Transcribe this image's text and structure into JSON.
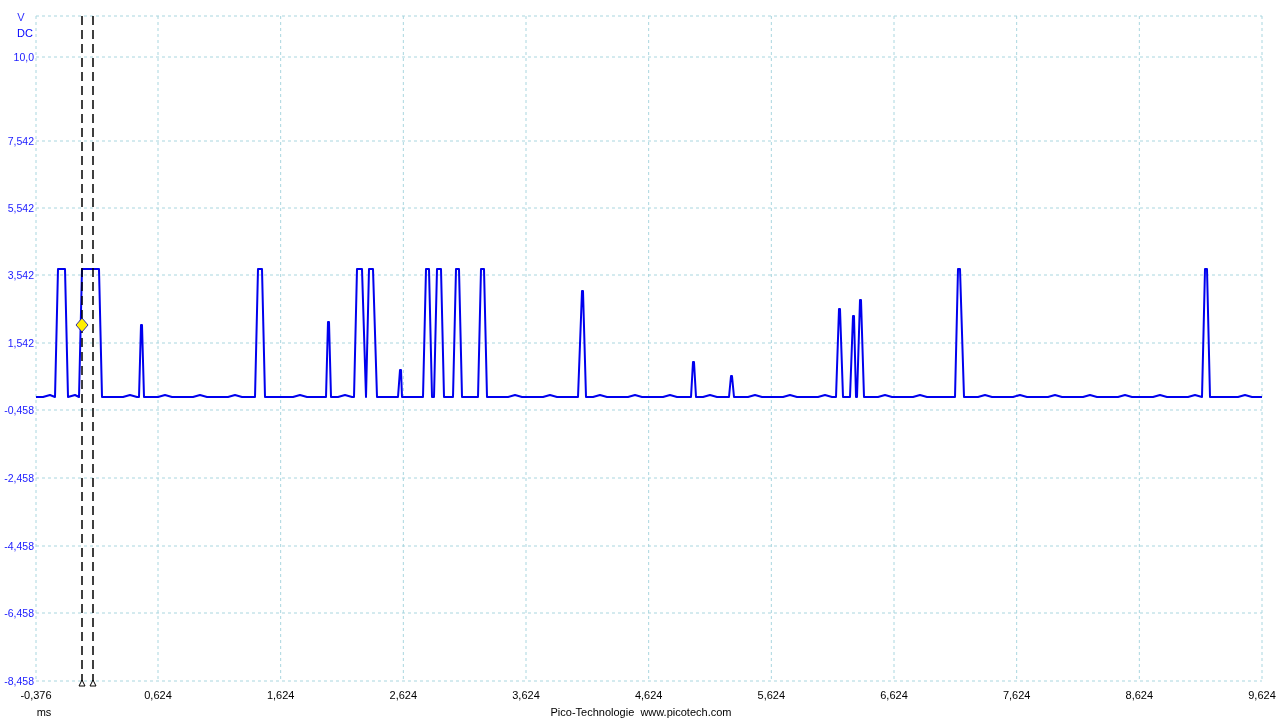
{
  "y_axis": {
    "unit": "V",
    "coupling": "DC",
    "ticks": [
      "10,0",
      "7,542",
      "5,542",
      "3,542",
      "1,542",
      "-0,458",
      "-2,458",
      "-4,458",
      "-6,458",
      "-8,458"
    ]
  },
  "x_axis": {
    "unit": "ms",
    "ticks": [
      "-0,376",
      "0,624",
      "1,624",
      "2,624",
      "3,624",
      "4,624",
      "5,624",
      "6,624",
      "7,624",
      "8,624",
      "9,624"
    ]
  },
  "footer": "Pico-Technologie  www.picotech.com"
}
